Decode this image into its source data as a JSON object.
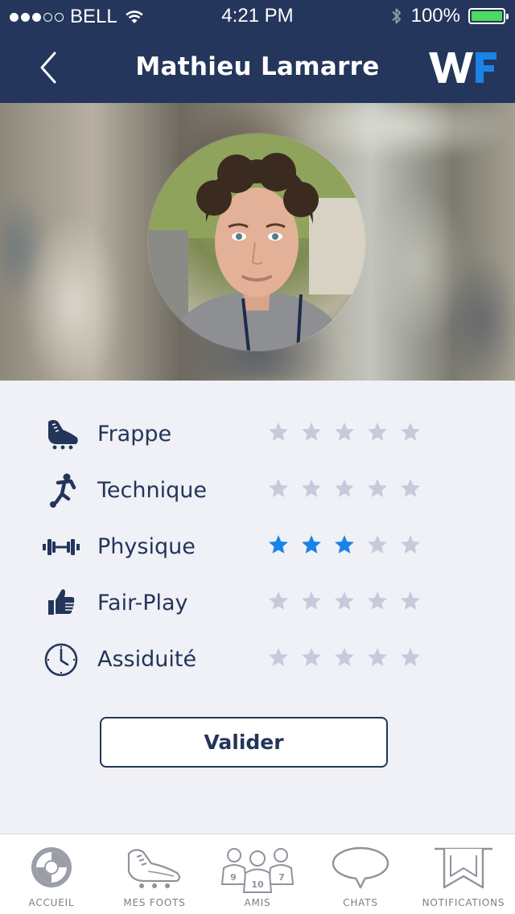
{
  "status_bar": {
    "carrier": "BELL",
    "signal_bars": 3,
    "signal_total": 5,
    "time": "4:21 PM",
    "battery": "100%",
    "battery_level": 1.0
  },
  "nav": {
    "title": "Mathieu Lamarre",
    "logo_text": "WF"
  },
  "colors": {
    "nav_background": "#24365b",
    "text": "#24355a",
    "star_filled": "#1a83e8",
    "star_empty": "#c5cbdb",
    "battery_green": "#4cd964"
  },
  "ratings": [
    {
      "label": "Frappe",
      "icon": "football-boot-icon",
      "stars": 0,
      "max": 5
    },
    {
      "label": "Technique",
      "icon": "player-kicking-icon",
      "stars": 0,
      "max": 5
    },
    {
      "label": "Physique",
      "icon": "dumbbell-icon",
      "stars": 3,
      "max": 5
    },
    {
      "label": "Fair-Play",
      "icon": "thumbs-up-icon",
      "stars": 0,
      "max": 5
    },
    {
      "label": "Assiduité",
      "icon": "clock-icon",
      "stars": 0,
      "max": 5
    }
  ],
  "validate_label": "Valider",
  "tabs": [
    {
      "label": "ACCUEIL",
      "icon": "home-swirl-icon"
    },
    {
      "label": "MES FOOTS",
      "icon": "football-boot-icon"
    },
    {
      "label": "AMIS",
      "icon": "friends-icon",
      "jersey_numbers": [
        "9",
        "10",
        "7"
      ]
    },
    {
      "label": "CHATS",
      "icon": "chat-bubble-icon"
    },
    {
      "label": "NOTIFICATIONS",
      "icon": "bookmark-icon"
    }
  ]
}
